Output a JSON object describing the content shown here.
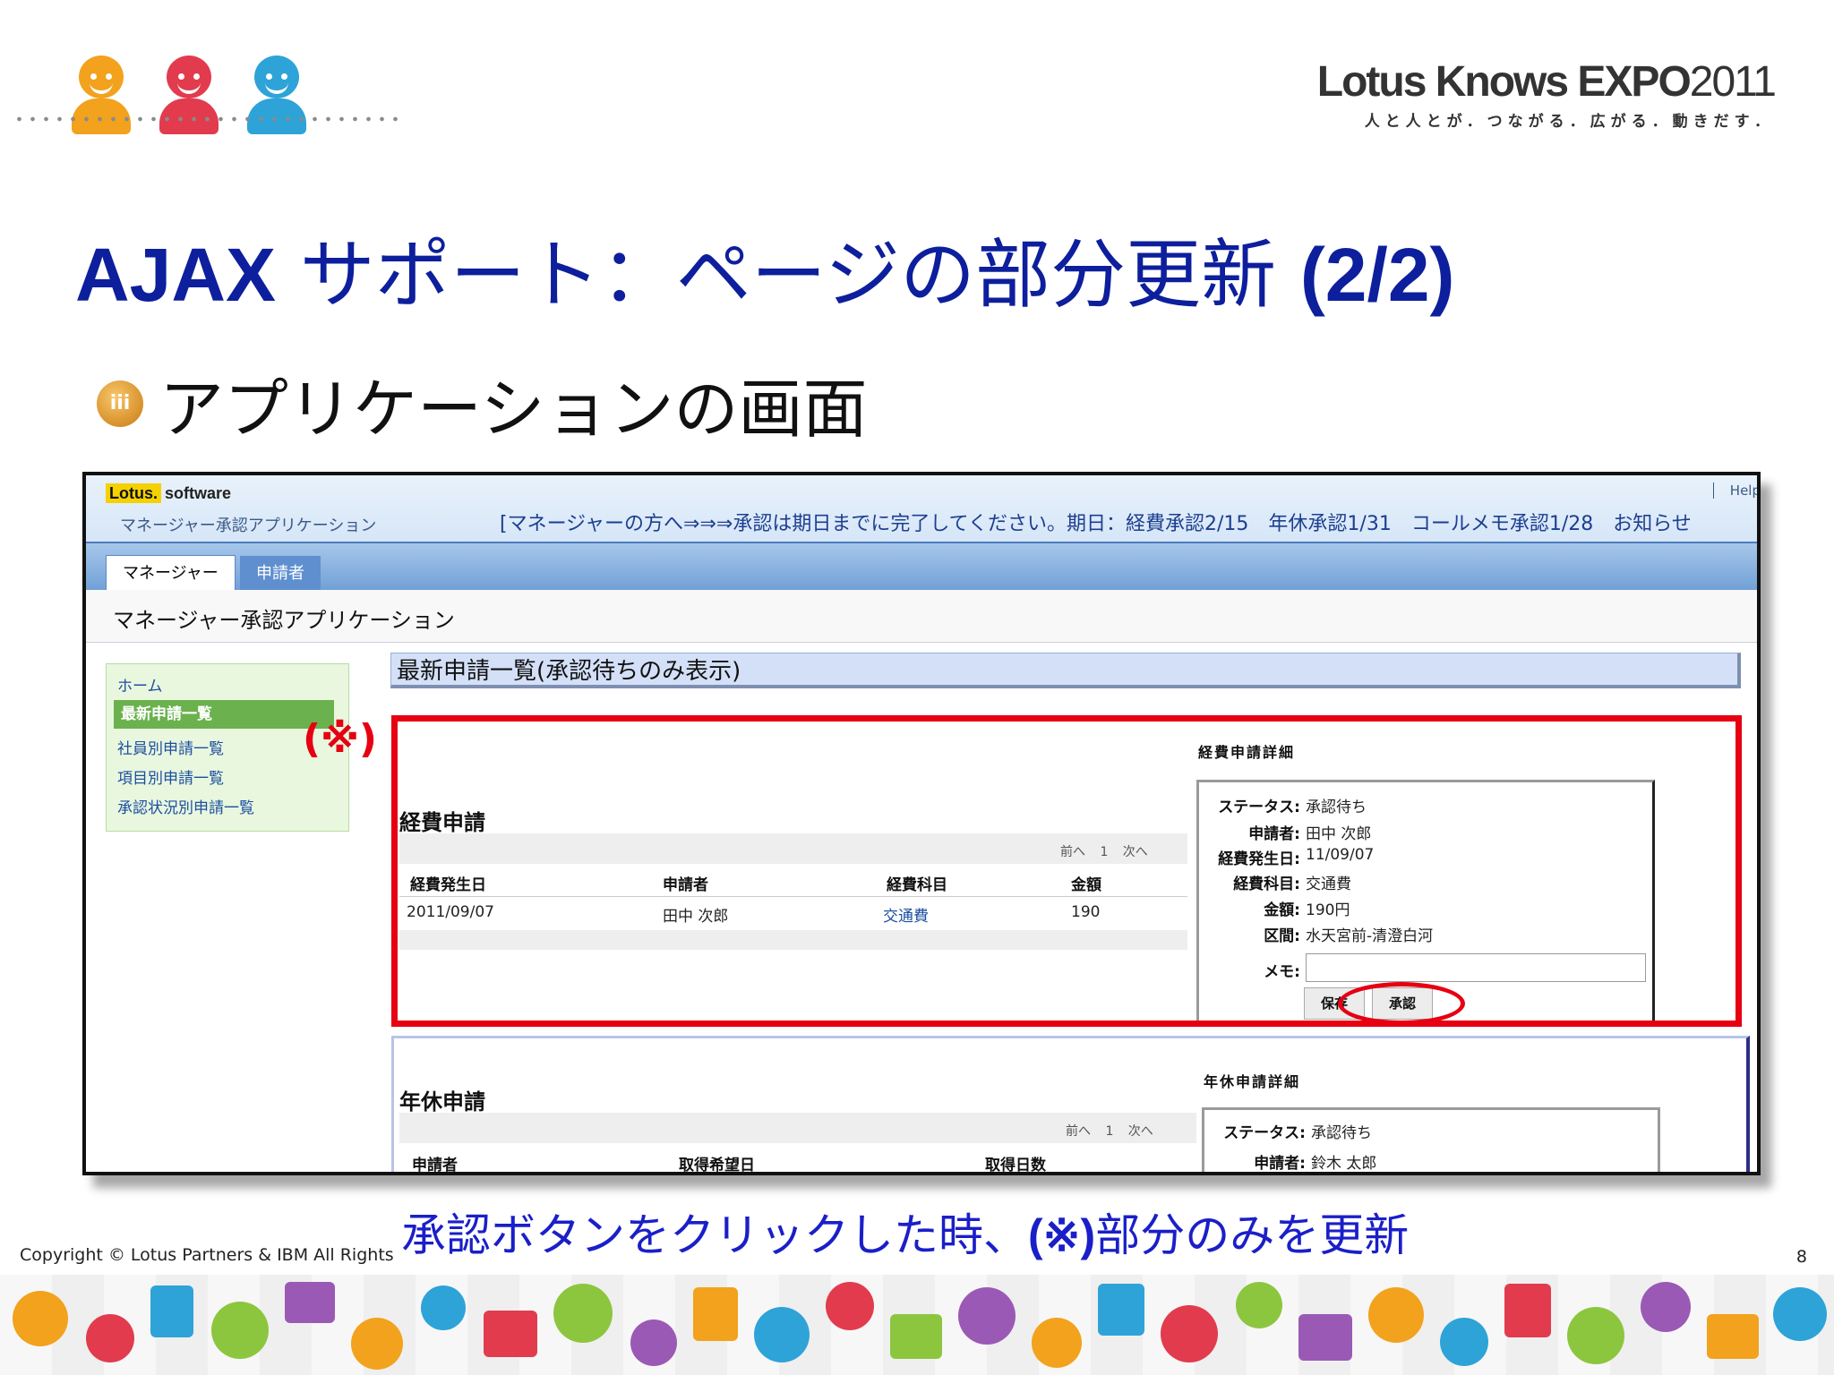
{
  "header": {
    "expo_brand": "Lotus Knows EXPO",
    "expo_year": "2011",
    "expo_tagline": "人と人とが．つながる．広がる．動きだす．"
  },
  "slide": {
    "title_latin": "AJAX",
    "title_jp": " サポート：ページの部分更新 ",
    "title_suffix": "(2/2)",
    "bullet_icon_text": "iii",
    "bullet_text": "アプリケーションの画面"
  },
  "app": {
    "logo_lotus": "Lotus.",
    "logo_software": "software",
    "app_name_small": "マネージャー承認アプリケーション",
    "help_label": "Help",
    "notice": "[マネージャーの方へ⇒⇒⇒承認は期日までに完了してください。期日：経費承認2/15　年休承認1/31　コールメモ承認1/28　お知らせ",
    "tabs": [
      "マネージャー",
      "申請者"
    ],
    "page_subtitle": "マネージャー承認アプリケーション",
    "nav": [
      "ホーム",
      "最新申請一覧",
      "社員別申請一覧",
      "項目別申請一覧",
      "承認状況別申請一覧"
    ],
    "list_title": "最新申請一覧(承認待ちのみ表示)",
    "expense": {
      "section_label": "経費申請",
      "pager": "前へ 1 次へ",
      "columns": [
        "経費発生日",
        "申請者",
        "経費科目",
        "金額"
      ],
      "row": [
        "2011/09/07",
        "田中 次郎",
        "交通費",
        "190"
      ],
      "detail_title": "経費申請詳細",
      "detail_labels": [
        "ステータス:",
        "申請者:",
        "経費発生日:",
        "経費科目:",
        "金額:",
        "区間:",
        "メモ:"
      ],
      "detail_values": [
        "承認待ち",
        "田中 次郎",
        "11/09/07",
        "交通費",
        "190円",
        "水天宮前-清澄白河"
      ],
      "btn_save": "保存",
      "btn_approve": "承認"
    },
    "leave": {
      "section_label": "年休申請",
      "pager": "前へ 1 次へ",
      "columns": [
        "申請者",
        "取得希望日",
        "取得日数"
      ],
      "detail_title": "年休申請詳細",
      "detail_labels": [
        "ステータス:",
        "申請者:"
      ],
      "detail_values": [
        "承認待ち",
        "鈴木 太郎"
      ]
    }
  },
  "annotations": {
    "marker": "(※)",
    "accent_color": "#e60012"
  },
  "footer": {
    "caption_a": "承認ボタンをクリックした時、",
    "caption_b": "(※)",
    "caption_c": "部分のみを更新",
    "copyright": "Copyright © Lotus Partners & IBM All Rights",
    "page_number": "8"
  },
  "colors": {
    "title_blue": "#0d1f9c",
    "caption_blue": "#1a1fc8",
    "nav_active_green": "#6bb24e",
    "tab_blue": "#6f9fd6"
  }
}
